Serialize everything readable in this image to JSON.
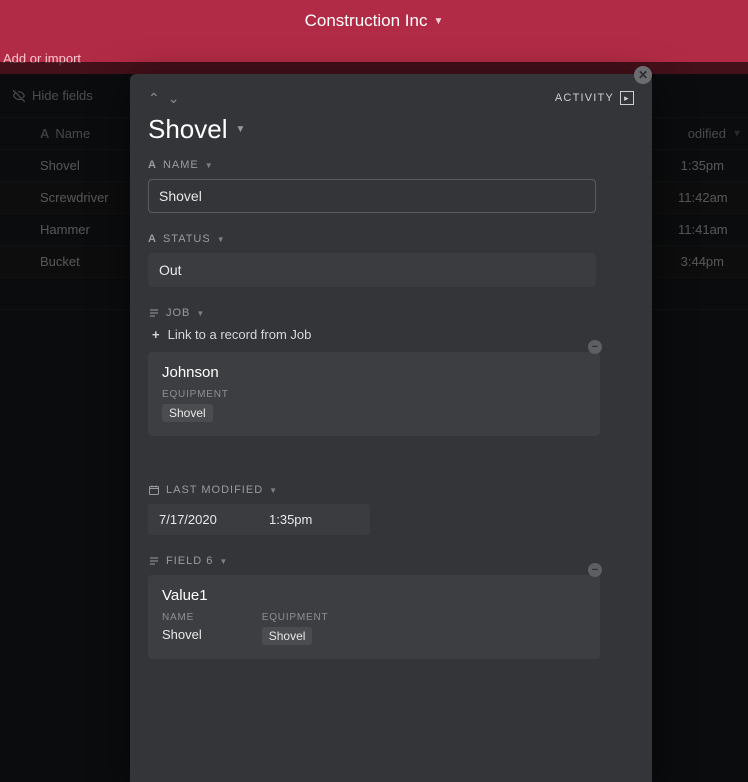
{
  "header": {
    "title": "Construction Inc"
  },
  "subheader": {
    "add_import": "Add or import"
  },
  "toolbar": {
    "hide_fields": "Hide fields",
    "activity_label": "ACTIVITY"
  },
  "table": {
    "columns": {
      "name": "Name",
      "last_modified_short": "odified"
    },
    "rows": [
      {
        "name": "Shovel",
        "time": "1:35pm"
      },
      {
        "name": "Screwdriver",
        "time": "11:42am"
      },
      {
        "name": "Hammer",
        "time": "11:41am"
      },
      {
        "name": "Bucket",
        "time": "3:44pm",
        "date_suffix": ")"
      }
    ]
  },
  "panel": {
    "title": "Shovel",
    "fields": {
      "name": {
        "label": "NAME",
        "value": "Shovel"
      },
      "status": {
        "label": "STATUS",
        "value": "Out"
      },
      "job": {
        "label": "JOB",
        "link_text": "Link to a record from Job",
        "card": {
          "title": "Johnson",
          "equipment_label": "EQUIPMENT",
          "equipment_value": "Shovel"
        }
      },
      "last_modified": {
        "label": "LAST MODIFIED",
        "date": "7/17/2020",
        "time": "1:35pm"
      },
      "field6": {
        "label": "FIELD 6",
        "card": {
          "title": "Value1",
          "name_label": "NAME",
          "name_value": "Shovel",
          "equipment_label": "EQUIPMENT",
          "equipment_value": "Shovel"
        }
      }
    }
  }
}
